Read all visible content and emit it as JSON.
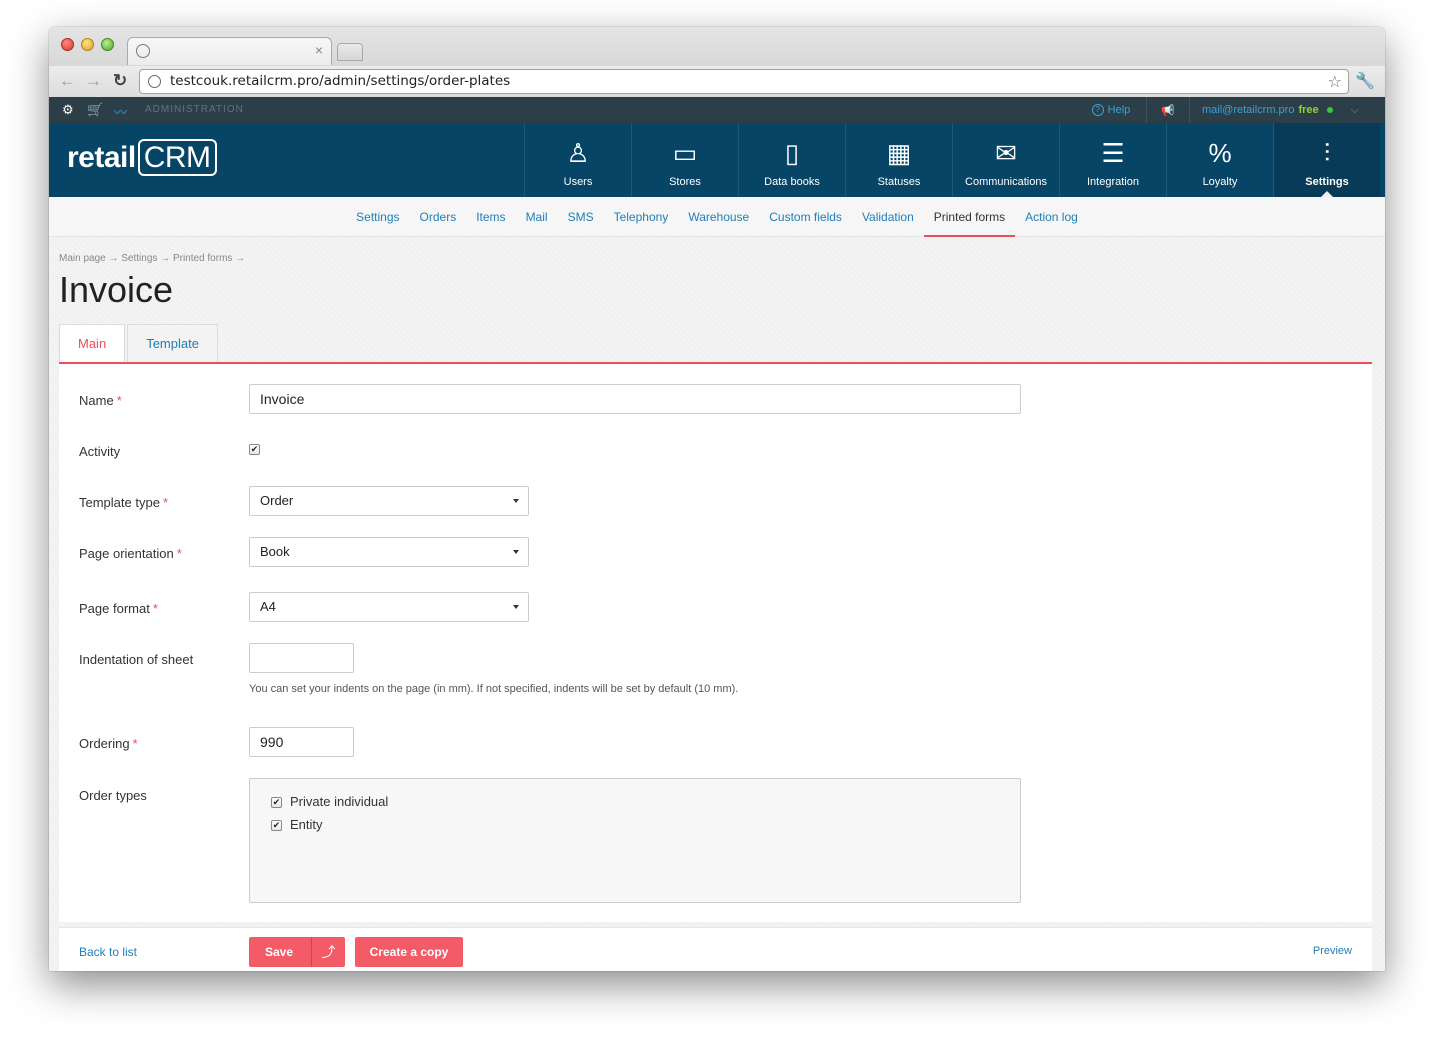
{
  "browser": {
    "url": "testcouk.retailcrm.pro/admin/settings/order-plates",
    "tab_close": "×"
  },
  "adminbar": {
    "label": "ADMINISTRATION",
    "help": "Help",
    "user_email": "mail@retailcrm.pro",
    "plan": "free"
  },
  "logo": {
    "text": "retail",
    "crm": "CRM"
  },
  "mainnav": [
    {
      "label": "Users",
      "icon": "user-icon",
      "glyph": "♙"
    },
    {
      "label": "Stores",
      "icon": "store-icon",
      "glyph": "▭"
    },
    {
      "label": "Data books",
      "icon": "book-icon",
      "glyph": "▯"
    },
    {
      "label": "Statuses",
      "icon": "statuses-icon",
      "glyph": "▦"
    },
    {
      "label": "Communications",
      "icon": "communications-icon",
      "glyph": "✉"
    },
    {
      "label": "Integration",
      "icon": "integration-icon",
      "glyph": "☰"
    },
    {
      "label": "Loyalty",
      "icon": "loyalty-icon",
      "glyph": "%"
    },
    {
      "label": "Settings",
      "icon": "settings-sliders-icon",
      "glyph": "⫶"
    }
  ],
  "subnav": [
    "Settings",
    "Orders",
    "Items",
    "Mail",
    "SMS",
    "Telephony",
    "Warehouse",
    "Custom fields",
    "Validation",
    "Printed forms",
    "Action log"
  ],
  "breadcrumb": "Main page → Settings → Printed forms →",
  "page_title": "Invoice",
  "tabs": {
    "main": "Main",
    "template": "Template"
  },
  "form": {
    "name_label": "Name",
    "name_value": "Invoice",
    "activity_label": "Activity",
    "template_type_label": "Template type",
    "template_type_value": "Order",
    "page_orientation_label": "Page orientation",
    "page_orientation_value": "Book",
    "page_format_label": "Page format",
    "page_format_value": "A4",
    "indentation_label": "Indentation of sheet",
    "indentation_value": "",
    "indentation_hint": "You can set your indents on the page (in mm). If not specified, indents will be set by default (10 mm).",
    "ordering_label": "Ordering",
    "ordering_value": "990",
    "order_types_label": "Order types",
    "order_types": [
      "Private individual",
      "Entity"
    ],
    "required_mark": "*"
  },
  "footer": {
    "back": "Back to list",
    "save": "Save",
    "save_up": "⤴",
    "copy": "Create a copy",
    "preview": "Preview"
  },
  "colors": {
    "header": "#064566",
    "accent": "#f35b66",
    "link": "#1f7fb6"
  }
}
